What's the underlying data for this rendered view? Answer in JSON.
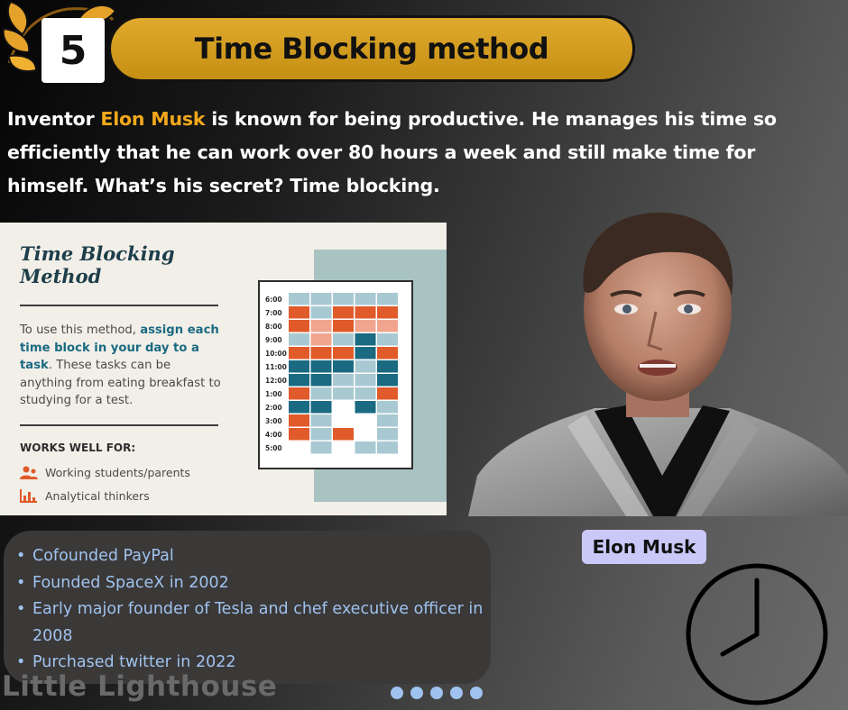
{
  "header": {
    "number": "5",
    "title": "Time Blocking method"
  },
  "intro": {
    "before": "Inventor ",
    "highlight": "Elon Musk",
    "after": " is known for being productive. He manages his time so efficiently that he can work over 80 hours a week and still make time for himself. What’s his secret? Time blocking."
  },
  "infographic": {
    "title": "Time Blocking Method",
    "desc_before": "To use this method, ",
    "desc_strong": "assign each time block in your day to a task",
    "desc_after": ". These tasks can be anything from eating breakfast to studying for a test.",
    "works_title": "WORKS WELL FOR:",
    "works_items": [
      {
        "icon": "people-icon",
        "label": "Working students/parents"
      },
      {
        "icon": "bar-chart-icon",
        "label": "Analytical thinkers"
      }
    ],
    "times": [
      "6:00",
      "7:00",
      "8:00",
      "9:00",
      "10:00",
      "11:00",
      "12:00",
      "1:00",
      "2:00",
      "3:00",
      "4:00",
      "5:00"
    ],
    "colors": {
      "orange": "#e05a2a",
      "teal": "#1a6a82",
      "light": "#a8c9d2",
      "peach": "#f1a58f"
    }
  },
  "portrait": {
    "name": "Elon Musk"
  },
  "facts": [
    "Cofounded PayPal",
    "Founded SpaceX in 2002",
    "Early major founder of Tesla and chef executive officer in 2008",
    "Purchased twitter in 2022"
  ],
  "brand": "Little Lighthouse",
  "colors": {
    "accent": "#d9a11f",
    "fact_text": "#9fc3ee",
    "highlight": "#f2a81c"
  }
}
